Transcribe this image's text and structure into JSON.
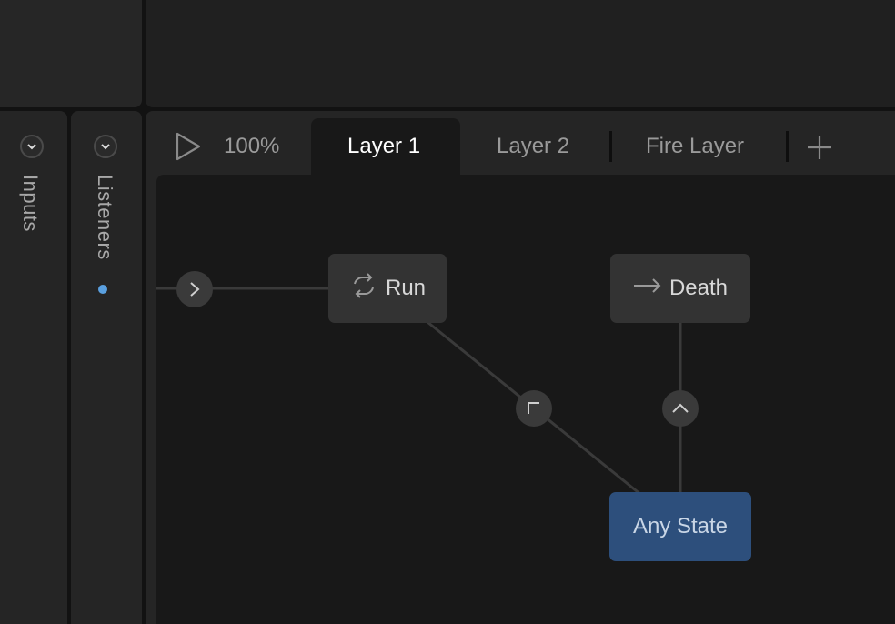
{
  "sidebar": {
    "inputs_label": "Inputs",
    "listeners_label": "Listeners"
  },
  "toolbar": {
    "zoom": "100%"
  },
  "tabs": [
    {
      "label": "Layer 1",
      "active": true
    },
    {
      "label": "Layer 2",
      "active": false
    },
    {
      "label": "Fire Layer",
      "active": false
    }
  ],
  "graph": {
    "nodes": {
      "run": {
        "label": "Run",
        "icon": "loop-icon"
      },
      "death": {
        "label": "Death",
        "icon": "arrow-right-icon"
      },
      "any_state": {
        "label": "Any State"
      }
    }
  },
  "colors": {
    "accent_blue": "#2d4f7c",
    "listener_dot": "#5aa0e0",
    "canvas": "#181818"
  }
}
